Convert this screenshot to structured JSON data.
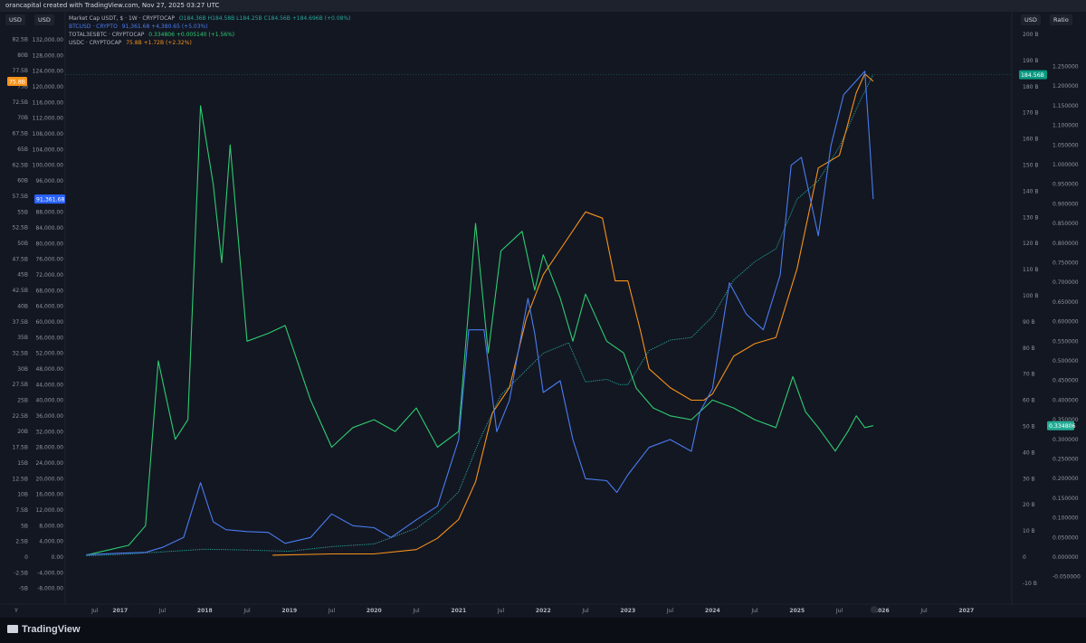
{
  "page": {
    "attribution": "orancapital created with TradingView.com, Nov 27, 2025 03:27 UTC",
    "brand": "TradingView",
    "scale_labels": {
      "left_outer": "USD",
      "left_inner": "USD",
      "right_inner": "USD",
      "right_outer": "Ratio"
    },
    "legend": [
      {
        "color": "#26a69a",
        "title": "Market Cap USDT, $ · 1W · CRYPTOCAP",
        "values": "O184.36B H184.58B L184.25B C184.56B +184.696B (+0.08%)"
      },
      {
        "color": "#2962ff",
        "title": "BTCUSD · CRYPTO",
        "values": "91,361.68 +4,380.65 (+5.03%)"
      },
      {
        "color": "#22c55e",
        "title": "TOTAL3ESBTC · CRYPTOCAP",
        "values": "0.334806 +0.005140 (+1.56%)"
      },
      {
        "color": "#f7931a",
        "title": "USDC · CRYPTOCAP",
        "values": "75.8B +1.72B (+2.32%)"
      }
    ],
    "price_tags": {
      "usdc": "75.8B",
      "btc": "91,361.68",
      "usdt": "184.56B",
      "ratio": "0.334806"
    }
  },
  "chart_data": {
    "type": "line",
    "colors": {
      "background": "#131722",
      "usdt": "#26a69a",
      "btc": "#4a7cf0",
      "ratio": "#2ecc71",
      "usdc": "#f7931a",
      "text": "#8f949e"
    },
    "x_ticks": [
      "Y",
      "Jul",
      "2017",
      "Jul",
      "2018",
      "Jul",
      "2019",
      "Jul",
      "2020",
      "Jul",
      "2021",
      "Jul",
      "2022",
      "Jul",
      "2023",
      "Jul",
      "2024",
      "Jul",
      "2025",
      "Jul",
      "2026",
      "Jul",
      "2027"
    ],
    "axes": {
      "usdc_billion": {
        "ticks": [
          "82.5B",
          "80B",
          "77.5B",
          "75B",
          "72.5B",
          "70B",
          "67.5B",
          "65B",
          "62.5B",
          "60B",
          "57.5B",
          "55B",
          "52.5B",
          "50B",
          "47.5B",
          "45B",
          "42.5B",
          "40B",
          "37.5B",
          "35B",
          "32.5B",
          "30B",
          "27.5B",
          "25B",
          "22.5B",
          "20B",
          "17.5B",
          "15B",
          "12.5B",
          "10B",
          "7.5B",
          "5B",
          "2.5B",
          "0",
          "-2.5B",
          "-5B"
        ]
      },
      "btc_usd": {
        "ticks": [
          "132,000.00",
          "128,000.00",
          "124,000.00",
          "120,000.00",
          "116,000.00",
          "112,000.00",
          "108,000.00",
          "104,000.00",
          "100,000.00",
          "96,000.00",
          "92,000.00",
          "88,000.00",
          "84,000.00",
          "80,000.00",
          "76,000.00",
          "72,000.00",
          "68,000.00",
          "64,000.00",
          "60,000.00",
          "56,000.00",
          "52,000.00",
          "48,000.00",
          "44,000.00",
          "40,000.00",
          "36,000.00",
          "32,000.00",
          "28,000.00",
          "24,000.00",
          "20,000.00",
          "16,000.00",
          "12,000.00",
          "8,000.00",
          "4,000.00",
          "0.00",
          "-4,000.00",
          "-8,000.00"
        ]
      },
      "usdt_billion": {
        "ticks": [
          "200 B",
          "190 B",
          "180 B",
          "170 B",
          "160 B",
          "150 B",
          "140 B",
          "130 B",
          "120 B",
          "110 B",
          "100 B",
          "90 B",
          "80 B",
          "70 B",
          "60 B",
          "50 B",
          "40 B",
          "30 B",
          "20 B",
          "10 B",
          "0",
          "-10 B"
        ]
      },
      "ratio": {
        "ticks": [
          "1.250000",
          "1.200000",
          "1.150000",
          "1.100000",
          "1.050000",
          "1.000000",
          "0.950000",
          "0.900000",
          "0.850000",
          "0.800000",
          "0.750000",
          "0.700000",
          "0.650000",
          "0.600000",
          "0.550000",
          "0.500000",
          "0.450000",
          "0.400000",
          "0.350000",
          "0.300000",
          "0.250000",
          "0.200000",
          "0.150000",
          "0.100000",
          "0.050000",
          "0.000000",
          "-0.050000"
        ]
      }
    },
    "series": [
      {
        "name": "Market Cap USDT",
        "axis": "usdt_billion",
        "points": [
          [
            2016.6,
            0.5
          ],
          [
            2017.0,
            1
          ],
          [
            2017.5,
            2
          ],
          [
            2018.0,
            3
          ],
          [
            2018.5,
            2.7
          ],
          [
            2019.0,
            2.2
          ],
          [
            2019.5,
            4
          ],
          [
            2020.0,
            5
          ],
          [
            2020.25,
            8
          ],
          [
            2020.5,
            11
          ],
          [
            2020.75,
            17
          ],
          [
            2021.0,
            25
          ],
          [
            2021.25,
            45
          ],
          [
            2021.5,
            62
          ],
          [
            2021.75,
            70
          ],
          [
            2022.0,
            78
          ],
          [
            2022.3,
            82
          ],
          [
            2022.5,
            67
          ],
          [
            2022.75,
            68
          ],
          [
            2022.9,
            66
          ],
          [
            2023.0,
            66
          ],
          [
            2023.25,
            79
          ],
          [
            2023.5,
            83
          ],
          [
            2023.75,
            84
          ],
          [
            2024.0,
            92
          ],
          [
            2024.25,
            106
          ],
          [
            2024.5,
            113
          ],
          [
            2024.75,
            118
          ],
          [
            2025.0,
            137
          ],
          [
            2025.25,
            144
          ],
          [
            2025.5,
            157
          ],
          [
            2025.75,
            175
          ],
          [
            2025.9,
            184.56
          ]
        ]
      },
      {
        "name": "BTCUSD",
        "axis": "btc_usd",
        "points": [
          [
            2016.6,
            600
          ],
          [
            2017.0,
            1000
          ],
          [
            2017.3,
            1200
          ],
          [
            2017.5,
            2500
          ],
          [
            2017.75,
            5000
          ],
          [
            2017.95,
            19000
          ],
          [
            2018.1,
            9000
          ],
          [
            2018.25,
            7000
          ],
          [
            2018.5,
            6500
          ],
          [
            2018.75,
            6300
          ],
          [
            2018.95,
            3500
          ],
          [
            2019.25,
            5000
          ],
          [
            2019.5,
            11000
          ],
          [
            2019.75,
            8000
          ],
          [
            2020.0,
            7500
          ],
          [
            2020.2,
            5000
          ],
          [
            2020.5,
            9500
          ],
          [
            2020.75,
            13000
          ],
          [
            2021.0,
            30000
          ],
          [
            2021.12,
            58000
          ],
          [
            2021.3,
            58000
          ],
          [
            2021.45,
            32000
          ],
          [
            2021.6,
            40000
          ],
          [
            2021.82,
            66000
          ],
          [
            2021.9,
            57000
          ],
          [
            2022.0,
            42000
          ],
          [
            2022.2,
            45000
          ],
          [
            2022.35,
            30000
          ],
          [
            2022.5,
            20000
          ],
          [
            2022.75,
            19500
          ],
          [
            2022.87,
            16500
          ],
          [
            2023.0,
            21000
          ],
          [
            2023.25,
            28000
          ],
          [
            2023.5,
            30000
          ],
          [
            2023.75,
            27000
          ],
          [
            2023.85,
            37000
          ],
          [
            2024.0,
            43000
          ],
          [
            2024.2,
            70000
          ],
          [
            2024.4,
            62000
          ],
          [
            2024.6,
            58000
          ],
          [
            2024.8,
            72000
          ],
          [
            2024.93,
            100000
          ],
          [
            2025.05,
            102000
          ],
          [
            2025.25,
            82000
          ],
          [
            2025.4,
            105000
          ],
          [
            2025.55,
            118000
          ],
          [
            2025.8,
            124000
          ],
          [
            2025.85,
            108000
          ],
          [
            2025.9,
            91361.68
          ]
        ]
      },
      {
        "name": "TOTAL3ESBTC",
        "axis": "ratio",
        "points": [
          [
            2016.6,
            0.005
          ],
          [
            2016.9,
            0.02
          ],
          [
            2017.1,
            0.03
          ],
          [
            2017.3,
            0.08
          ],
          [
            2017.45,
            0.5
          ],
          [
            2017.55,
            0.4
          ],
          [
            2017.65,
            0.3
          ],
          [
            2017.8,
            0.35
          ],
          [
            2017.95,
            1.15
          ],
          [
            2018.1,
            0.95
          ],
          [
            2018.2,
            0.75
          ],
          [
            2018.3,
            1.05
          ],
          [
            2018.5,
            0.55
          ],
          [
            2018.75,
            0.57
          ],
          [
            2018.95,
            0.59
          ],
          [
            2019.25,
            0.4
          ],
          [
            2019.5,
            0.28
          ],
          [
            2019.75,
            0.33
          ],
          [
            2020.0,
            0.35
          ],
          [
            2020.25,
            0.32
          ],
          [
            2020.5,
            0.38
          ],
          [
            2020.75,
            0.28
          ],
          [
            2021.0,
            0.32
          ],
          [
            2021.2,
            0.85
          ],
          [
            2021.35,
            0.52
          ],
          [
            2021.5,
            0.78
          ],
          [
            2021.75,
            0.83
          ],
          [
            2021.9,
            0.68
          ],
          [
            2022.0,
            0.77
          ],
          [
            2022.2,
            0.66
          ],
          [
            2022.35,
            0.55
          ],
          [
            2022.5,
            0.67
          ],
          [
            2022.75,
            0.55
          ],
          [
            2022.95,
            0.52
          ],
          [
            2023.1,
            0.43
          ],
          [
            2023.3,
            0.38
          ],
          [
            2023.5,
            0.36
          ],
          [
            2023.75,
            0.35
          ],
          [
            2024.0,
            0.4
          ],
          [
            2024.25,
            0.38
          ],
          [
            2024.5,
            0.35
          ],
          [
            2024.75,
            0.33
          ],
          [
            2024.95,
            0.46
          ],
          [
            2025.1,
            0.37
          ],
          [
            2025.25,
            0.33
          ],
          [
            2025.45,
            0.27
          ],
          [
            2025.6,
            0.32
          ],
          [
            2025.7,
            0.36
          ],
          [
            2025.8,
            0.33
          ],
          [
            2025.9,
            0.334806
          ]
        ]
      },
      {
        "name": "USDC",
        "axis": "usdc_billion",
        "points": [
          [
            2018.8,
            0.3
          ],
          [
            2019.5,
            0.5
          ],
          [
            2020.0,
            0.5
          ],
          [
            2020.5,
            1.2
          ],
          [
            2020.75,
            3
          ],
          [
            2021.0,
            6
          ],
          [
            2021.2,
            12
          ],
          [
            2021.4,
            23
          ],
          [
            2021.6,
            27
          ],
          [
            2021.8,
            38
          ],
          [
            2022.0,
            45
          ],
          [
            2022.25,
            50
          ],
          [
            2022.5,
            55
          ],
          [
            2022.7,
            54
          ],
          [
            2022.85,
            44
          ],
          [
            2023.0,
            44
          ],
          [
            2023.15,
            36
          ],
          [
            2023.25,
            30
          ],
          [
            2023.5,
            27
          ],
          [
            2023.75,
            25
          ],
          [
            2023.9,
            25
          ],
          [
            2024.0,
            26
          ],
          [
            2024.25,
            32
          ],
          [
            2024.5,
            34
          ],
          [
            2024.75,
            35
          ],
          [
            2025.0,
            46
          ],
          [
            2025.25,
            62
          ],
          [
            2025.5,
            64
          ],
          [
            2025.7,
            74
          ],
          [
            2025.8,
            77
          ],
          [
            2025.9,
            75.8
          ]
        ]
      }
    ]
  }
}
